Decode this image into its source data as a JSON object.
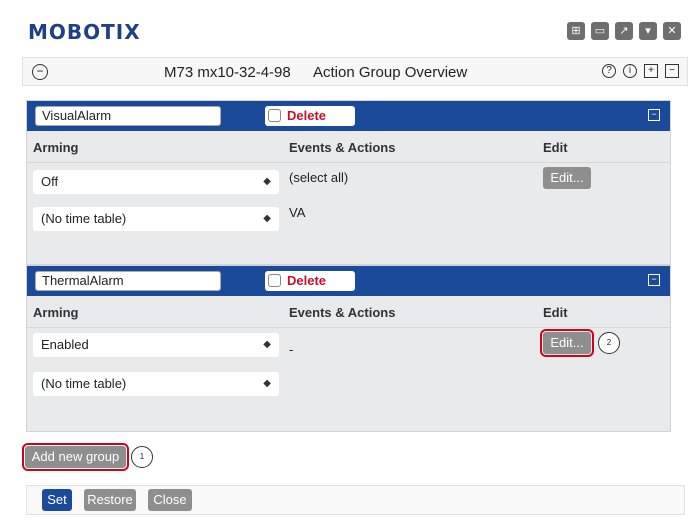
{
  "brand": {
    "logo": "MOBOTIX"
  },
  "top_icons": [
    "grid-icon",
    "window-icon",
    "external-link-icon",
    "dropdown-icon",
    "close-icon"
  ],
  "title_bar": {
    "camera_name": "M73 mx10-32-4-98",
    "page_name": "Action Group Overview",
    "icons": [
      "help-icon",
      "info-icon",
      "expand-all-icon",
      "collapse-all-icon"
    ]
  },
  "columns": {
    "arming": "Arming",
    "events": "Events & Actions",
    "edit": "Edit"
  },
  "groups": [
    {
      "name": "VisualAlarm",
      "delete_label": "Delete",
      "arming_value": "Off",
      "timetable_value": "(No time table)",
      "events": [
        "(select all)",
        "VA"
      ],
      "edit_label": "Edit..."
    },
    {
      "name": "ThermalAlarm",
      "delete_label": "Delete",
      "arming_value": "Enabled",
      "timetable_value": "(No time table)",
      "events": [
        "-"
      ],
      "edit_label": "Edit...",
      "callout": "2"
    }
  ],
  "add_group": {
    "label": "Add new group",
    "callout": "1"
  },
  "footer": {
    "set_label": "Set",
    "restore_label": "Restore",
    "close_label": "Close"
  },
  "colors": {
    "header_blue": "#1c4a9a",
    "delete_red": "#c8102e",
    "highlight_red": "#d0021b",
    "button_gray": "#8e8e8e"
  }
}
